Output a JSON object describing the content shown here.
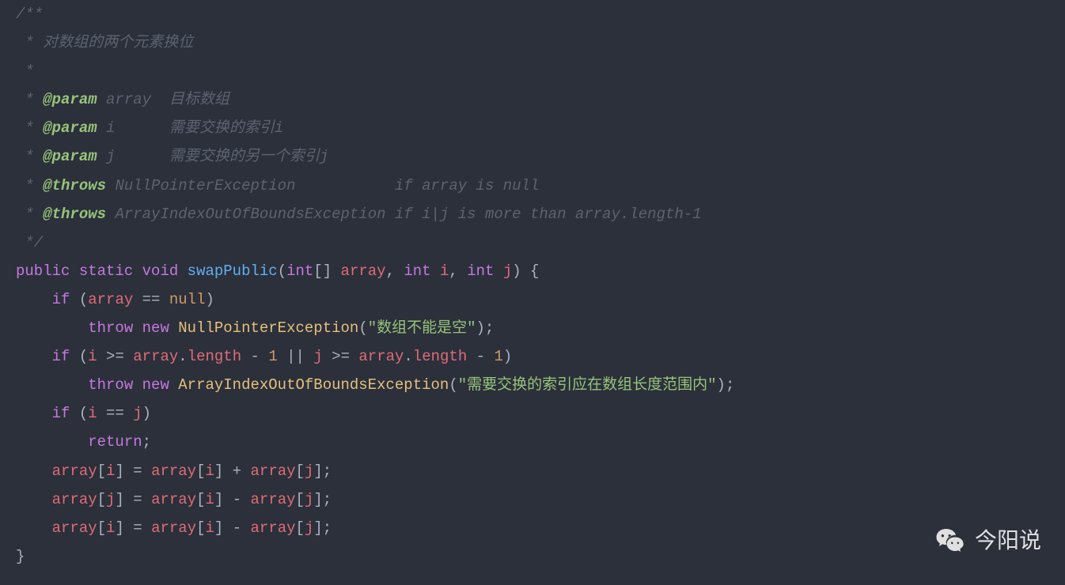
{
  "code": {
    "comment_open": "/**",
    "comment_desc_prefix": " * ",
    "comment_desc": "对数组的两个元素换位",
    "comment_empty": " *",
    "param_tag": "@param",
    "param1_name": "array",
    "param1_desc": "目标数组",
    "param2_name": "i",
    "param2_desc": "需要交换的索引i",
    "param3_name": "j",
    "param3_desc": "需要交换的另一个索引j",
    "throws_tag": "@throws",
    "throws1_type": "NullPointerException",
    "throws1_desc": "if array is null",
    "throws2_type": "ArrayIndexOutOfBoundsException",
    "throws2_desc": "if i|j is more than array.length-1",
    "comment_close": " */",
    "kw_public": "public",
    "kw_static": "static",
    "kw_void": "void",
    "method_name": "swapPublic",
    "kw_int": "int",
    "param_array": "array",
    "param_i": "i",
    "param_j": "j",
    "kw_if": "if",
    "kw_null": "null",
    "kw_throw": "throw",
    "kw_new": "new",
    "exception1": "NullPointerException",
    "string1": "\"数组不能是空\"",
    "prop_length": "length",
    "num_1": "1",
    "exception2": "ArrayIndexOutOfBoundsException",
    "string2": "\"需要交换的索引应在数组长度范围内\"",
    "kw_return": "return",
    "swap_line1_lhs_var": "array",
    "swap_line1_lhs_idx": "i"
  },
  "watermark": {
    "text": "今阳说"
  }
}
